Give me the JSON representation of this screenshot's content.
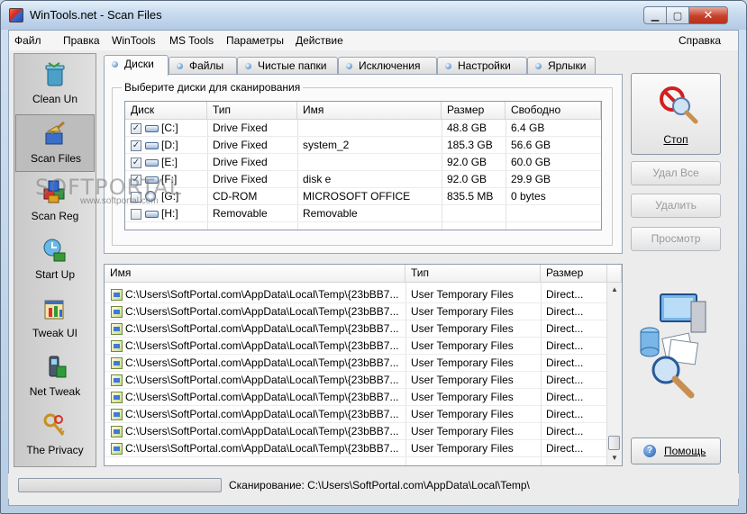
{
  "window": {
    "title": "WinTools.net - Scan Files"
  },
  "menu": [
    "Файл",
    "Правка",
    "WinTools",
    "MS Tools",
    "Параметры",
    "Действие"
  ],
  "menu_right": "Справка",
  "sidebar": [
    {
      "label": "Clean Un",
      "icon": "trash-can-icon"
    },
    {
      "label": "Scan Files",
      "icon": "broom-icon",
      "selected": true
    },
    {
      "label": "Scan Reg",
      "icon": "cubes-icon"
    },
    {
      "label": "Start Up",
      "icon": "clock-globe-icon"
    },
    {
      "label": "Tweak UI",
      "icon": "window-tweak-icon"
    },
    {
      "label": "Net Tweak",
      "icon": "phone-icon"
    },
    {
      "label": "The Privacy",
      "icon": "keys-icon"
    }
  ],
  "tabs": [
    "Диски",
    "Файлы",
    "Чистые папки",
    "Исключения",
    "Настройки",
    "Ярлыки"
  ],
  "drives": {
    "group_title": "Выберите диски для сканирования",
    "headers": [
      "Диск",
      "Тип",
      "Имя",
      "Размер",
      "Свободно"
    ],
    "rows": [
      {
        "drive": "[C:]",
        "type": "Drive Fixed",
        "name": "",
        "size": "48.8 GB",
        "free": "6.4 GB",
        "checked": true,
        "icon": "hard-drive-icon"
      },
      {
        "drive": "[D:]",
        "type": "Drive Fixed",
        "name": "system_2",
        "size": "185.3 GB",
        "free": "56.6 GB",
        "checked": true,
        "icon": "hard-drive-icon"
      },
      {
        "drive": "[E:]",
        "type": "Drive Fixed",
        "name": "",
        "size": "92.0 GB",
        "free": "60.0 GB",
        "checked": true,
        "icon": "hard-drive-icon"
      },
      {
        "drive": "[F:]",
        "type": "Drive Fixed",
        "name": "disk e",
        "size": "92.0 GB",
        "free": "29.9 GB",
        "checked": true,
        "icon": "hard-drive-icon"
      },
      {
        "drive": "[G:]",
        "type": "CD-ROM",
        "name": "MICROSOFT OFFICE",
        "size": "835.5 MB",
        "free": "0 bytes",
        "checked": false,
        "icon": "cd-rom-icon"
      },
      {
        "drive": "[H:]",
        "type": "Removable",
        "name": "Removable",
        "size": "",
        "free": "",
        "checked": false,
        "icon": "removable-drive-icon"
      }
    ]
  },
  "results": {
    "headers": [
      "Имя",
      "Тип",
      "Размер"
    ],
    "rows": [
      {
        "name": "C:\\Users\\SoftPortal.com\\AppData\\Local\\Temp\\{23bBB7...",
        "type": "User Temporary Files",
        "size": "Direct..."
      },
      {
        "name": "C:\\Users\\SoftPortal.com\\AppData\\Local\\Temp\\{23bBB7...",
        "type": "User Temporary Files",
        "size": "Direct..."
      },
      {
        "name": "C:\\Users\\SoftPortal.com\\AppData\\Local\\Temp\\{23bBB7...",
        "type": "User Temporary Files",
        "size": "Direct..."
      },
      {
        "name": "C:\\Users\\SoftPortal.com\\AppData\\Local\\Temp\\{23bBB7...",
        "type": "User Temporary Files",
        "size": "Direct..."
      },
      {
        "name": "C:\\Users\\SoftPortal.com\\AppData\\Local\\Temp\\{23bBB7...",
        "type": "User Temporary Files",
        "size": "Direct..."
      },
      {
        "name": "C:\\Users\\SoftPortal.com\\AppData\\Local\\Temp\\{23bBB7...",
        "type": "User Temporary Files",
        "size": "Direct..."
      },
      {
        "name": "C:\\Users\\SoftPortal.com\\AppData\\Local\\Temp\\{23bBB7...",
        "type": "User Temporary Files",
        "size": "Direct..."
      },
      {
        "name": "C:\\Users\\SoftPortal.com\\AppData\\Local\\Temp\\{23bBB7...",
        "type": "User Temporary Files",
        "size": "Direct..."
      },
      {
        "name": "C:\\Users\\SoftPortal.com\\AppData\\Local\\Temp\\{23bBB7...",
        "type": "User Temporary Files",
        "size": "Direct..."
      },
      {
        "name": "C:\\Users\\SoftPortal.com\\AppData\\Local\\Temp\\{23bBB7...",
        "type": "User Temporary Files",
        "size": "Direct..."
      }
    ]
  },
  "buttons": {
    "stop": "Стоп",
    "delete_all": "Удал Все",
    "delete": "Удалить",
    "view": "Просмотр",
    "help": "Помощь"
  },
  "status": {
    "text": "Сканирование: C:\\Users\\SoftPortal.com\\AppData\\Local\\Temp\\",
    "progress": 0.0
  },
  "watermark": {
    "text": "SOFTPORTAL",
    "url": "www.softportal.com"
  },
  "colors": {
    "accent": "#3f7ad8",
    "stop_red": "#d21e1e",
    "progress_green": "#57b83a"
  }
}
